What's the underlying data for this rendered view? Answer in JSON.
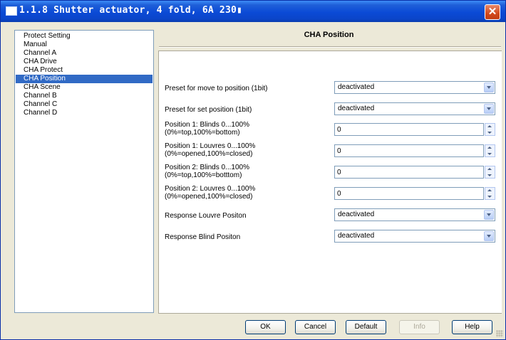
{
  "window": {
    "title": "1.1.8 Shutter actuator, 4 fold, 6A 230▮",
    "close_icon": "close-icon"
  },
  "nav": {
    "items": [
      {
        "label": "Protect Setting"
      },
      {
        "label": "Manual"
      },
      {
        "label": "Channel A"
      },
      {
        "label": "CHA Drive"
      },
      {
        "label": "CHA Protect"
      },
      {
        "label": "CHA Position",
        "selected": true
      },
      {
        "label": "CHA Scene"
      },
      {
        "label": "Channel B"
      },
      {
        "label": "Channel C"
      },
      {
        "label": "Channel D"
      }
    ]
  },
  "panel": {
    "title": "CHA Position",
    "rows": [
      {
        "label": "Preset for move to position (1bit)",
        "type": "select",
        "value": "deactivated"
      },
      {
        "label": "Preset for set position (1bit)",
        "type": "select",
        "value": "deactivated"
      },
      {
        "label": "Position 1: Blinds 0...100%",
        "label2": "(0%=top,100%=bottom)",
        "type": "spin",
        "value": "0"
      },
      {
        "label": "Position 1: Louvres 0...100%",
        "label2": "(0%=opened,100%=closed)",
        "type": "spin",
        "value": "0"
      },
      {
        "label": "Position 2: Blinds 0...100%",
        "label2": "(0%=top,100%=botttom)",
        "type": "spin",
        "value": "0"
      },
      {
        "label": "Position 2: Louvres 0...100%",
        "label2": "(0%=opened,100%=closed)",
        "type": "spin",
        "value": "0"
      },
      {
        "label": "Response Louvre Positon",
        "type": "select",
        "value": "deactivated"
      },
      {
        "label": "Response Blind Positon",
        "type": "select",
        "value": "deactivated"
      }
    ]
  },
  "buttons": {
    "ok": "OK",
    "cancel": "Cancel",
    "default": "Default",
    "info": "Info",
    "help": "Help"
  },
  "colors": {
    "titlebar": "#0b4ad6",
    "selection": "#316ac5",
    "dialog_bg": "#ece9d8"
  }
}
